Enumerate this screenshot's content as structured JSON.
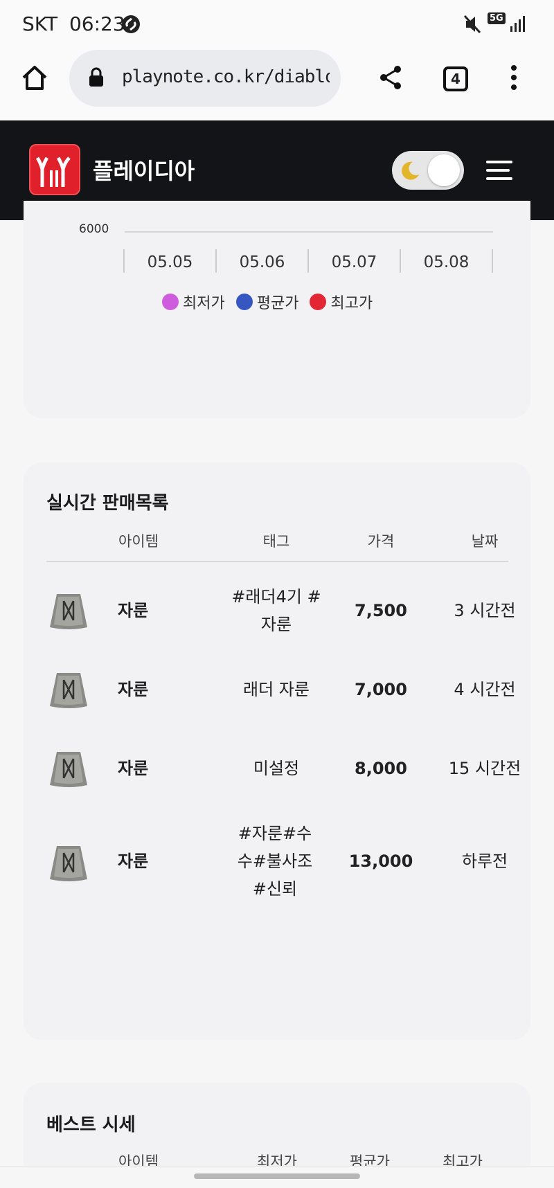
{
  "status_bar": {
    "carrier": "SKT",
    "time": "06:23",
    "network": "5G"
  },
  "browser": {
    "url": "playnote.co.kr/diablo/hor",
    "tab_count": "4"
  },
  "site": {
    "name": "플레이디아"
  },
  "chart": {
    "y_tick": "6000",
    "x_ticks": [
      "05.05",
      "05.06",
      "05.07",
      "05.08"
    ],
    "legend": [
      {
        "label": "최저가",
        "color": "#cf5cdc"
      },
      {
        "label": "평균가",
        "color": "#3656c2"
      },
      {
        "label": "최고가",
        "color": "#e32633"
      }
    ]
  },
  "sales": {
    "title": "실시간 판매목록",
    "headers": {
      "item": "아이템",
      "tag": "태그",
      "price": "가격",
      "date": "날짜"
    },
    "rows": [
      {
        "name": "자룬",
        "tag": "#래더4기 #자룬",
        "price": "7,500",
        "date": "3 시간전"
      },
      {
        "name": "자룬",
        "tag": "래더 자룬",
        "price": "7,000",
        "date": "4 시간전"
      },
      {
        "name": "자룬",
        "tag": "미설정",
        "price": "8,000",
        "date": "15 시간전"
      },
      {
        "name": "자룬",
        "tag": "#자룬#수수#불사조#신뢰",
        "price": "13,000",
        "date": "하루전"
      }
    ]
  },
  "best": {
    "title": "베스트 시세",
    "headers": {
      "item": "아이템",
      "min": "최저가",
      "avg": "평균가",
      "max": "최고가"
    }
  }
}
